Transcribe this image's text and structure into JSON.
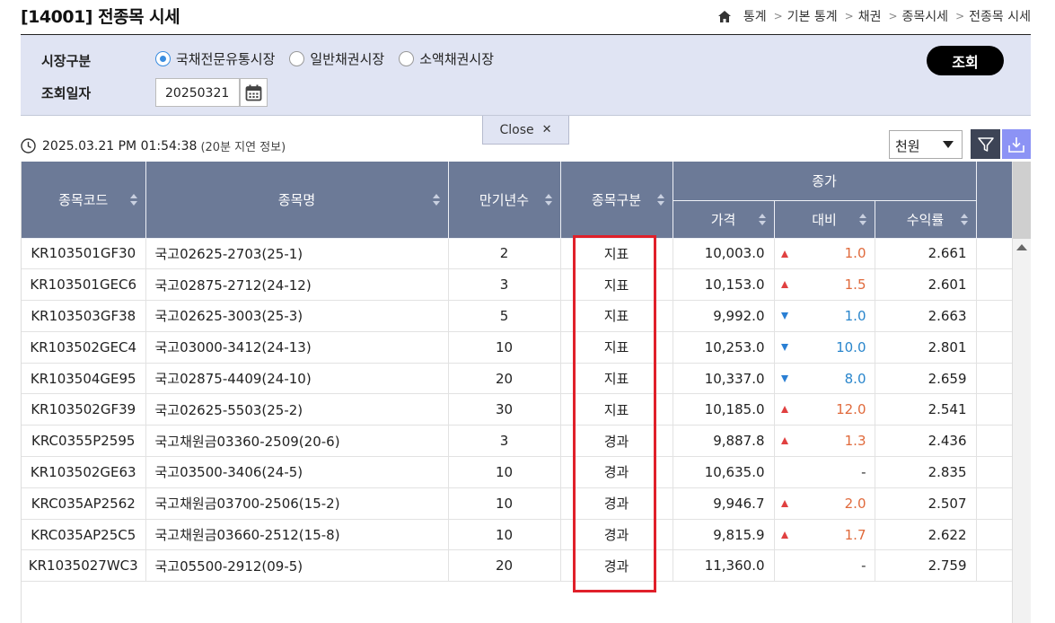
{
  "page": {
    "title": "[14001] 전종목 시세",
    "breadcrumb": [
      "통계",
      "기본 통계",
      "채권",
      "종목시세",
      "전종목 시세"
    ]
  },
  "search": {
    "market_label": "시장구분",
    "market_options": [
      {
        "label": "국채전문유통시장",
        "selected": true
      },
      {
        "label": "일반채권시장",
        "selected": false
      },
      {
        "label": "소액채권시장",
        "selected": false
      }
    ],
    "date_label": "조회일자",
    "date_value": "20250321",
    "search_button": "조회",
    "close_tab": "Close"
  },
  "info": {
    "timestamp": "2025.03.21 PM 01:54:38",
    "delay_note": "(20분 지연 정보)",
    "unit": "천원"
  },
  "table": {
    "headers": {
      "code": "종목코드",
      "name": "종목명",
      "maturity": "만기년수",
      "type": "종목구분",
      "close_group": "종가",
      "price": "가격",
      "change": "대비",
      "yield": "수익률"
    },
    "rows": [
      {
        "code": "KR103501GF30",
        "name": "국고02625-2703(25-1)",
        "maturity": "2",
        "type": "지표",
        "price": "10,003.0",
        "dir": "up",
        "change": "1.0",
        "yield": "2.661"
      },
      {
        "code": "KR103501GEC6",
        "name": "국고02875-2712(24-12)",
        "maturity": "3",
        "type": "지표",
        "price": "10,153.0",
        "dir": "up",
        "change": "1.5",
        "yield": "2.601"
      },
      {
        "code": "KR103503GF38",
        "name": "국고02625-3003(25-3)",
        "maturity": "5",
        "type": "지표",
        "price": "9,992.0",
        "dir": "down",
        "change": "1.0",
        "yield": "2.663"
      },
      {
        "code": "KR103502GEC4",
        "name": "국고03000-3412(24-13)",
        "maturity": "10",
        "type": "지표",
        "price": "10,253.0",
        "dir": "down",
        "change": "10.0",
        "yield": "2.801"
      },
      {
        "code": "KR103504GE95",
        "name": "국고02875-4409(24-10)",
        "maturity": "20",
        "type": "지표",
        "price": "10,337.0",
        "dir": "down",
        "change": "8.0",
        "yield": "2.659"
      },
      {
        "code": "KR103502GF39",
        "name": "국고02625-5503(25-2)",
        "maturity": "30",
        "type": "지표",
        "price": "10,185.0",
        "dir": "up",
        "change": "12.0",
        "yield": "2.541"
      },
      {
        "code": "KRC0355P2595",
        "name": "국고채원금03360-2509(20-6)",
        "maturity": "3",
        "type": "경과",
        "price": "9,887.8",
        "dir": "up",
        "change": "1.3",
        "yield": "2.436"
      },
      {
        "code": "KR103502GE63",
        "name": "국고03500-3406(24-5)",
        "maturity": "10",
        "type": "경과",
        "price": "10,635.0",
        "dir": "none",
        "change": "-",
        "yield": "2.835"
      },
      {
        "code": "KRC035AP2562",
        "name": "국고채원금03700-2506(15-2)",
        "maturity": "10",
        "type": "경과",
        "price": "9,946.7",
        "dir": "up",
        "change": "2.0",
        "yield": "2.507"
      },
      {
        "code": "KRC035AP25C5",
        "name": "국고채원금03660-2512(15-8)",
        "maturity": "10",
        "type": "경과",
        "price": "9,815.9",
        "dir": "up",
        "change": "1.7",
        "yield": "2.622"
      },
      {
        "code": "KR1035027WC3",
        "name": "국고05500-2912(09-5)",
        "maturity": "20",
        "type": "경과",
        "price": "11,360.0",
        "dir": "none",
        "change": "-",
        "yield": "2.759"
      }
    ]
  }
}
